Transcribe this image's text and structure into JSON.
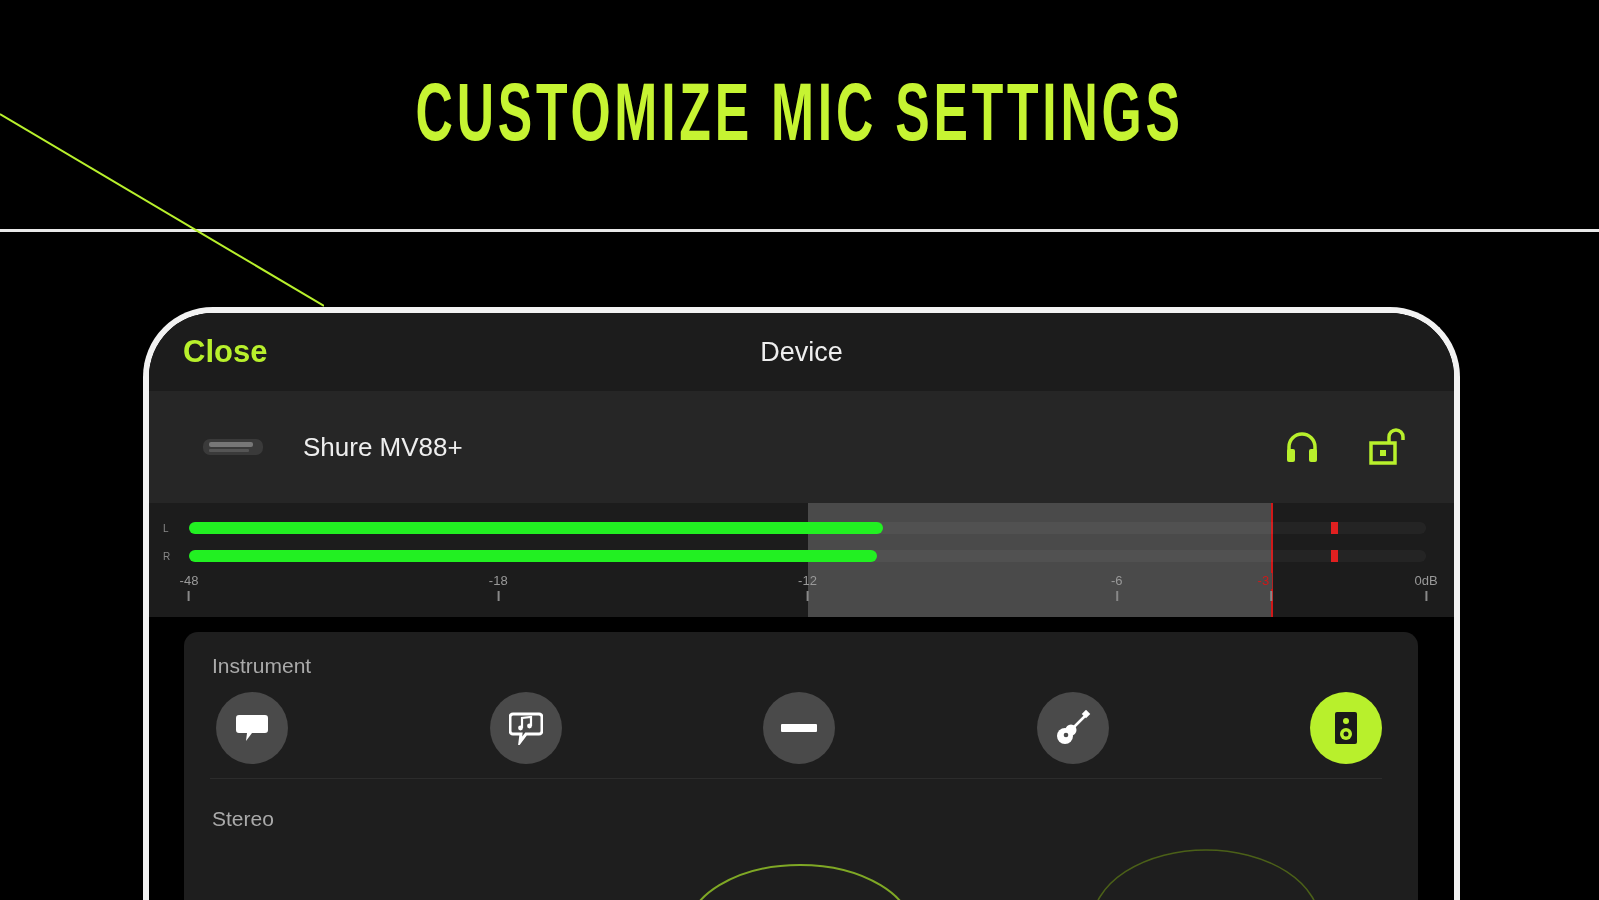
{
  "headline": "CUSTOMIZE MIC SETTINGS",
  "nav": {
    "close": "Close",
    "title": "Device"
  },
  "device": {
    "name": "Shure MV88+"
  },
  "meter": {
    "channels": [
      {
        "label": "L",
        "level": 0.561
      },
      {
        "label": "R",
        "level": 0.556
      }
    ],
    "ticks": [
      {
        "label": "-48",
        "kind": "normal"
      },
      {
        "label": "-18",
        "kind": "normal"
      },
      {
        "label": "-12",
        "kind": "normal"
      },
      {
        "label": "-6",
        "kind": "normal"
      },
      {
        "label": "-3",
        "kind": "limit"
      },
      {
        "label": "0dB",
        "kind": "normal"
      }
    ]
  },
  "instrument": {
    "title": "Instrument",
    "presets": [
      {
        "kind": "speech",
        "selected": false
      },
      {
        "kind": "singing",
        "selected": false
      },
      {
        "kind": "flat",
        "selected": false
      },
      {
        "kind": "acoustic",
        "selected": false
      },
      {
        "kind": "loud",
        "selected": true
      }
    ]
  },
  "stereo": {
    "title": "Stereo"
  }
}
